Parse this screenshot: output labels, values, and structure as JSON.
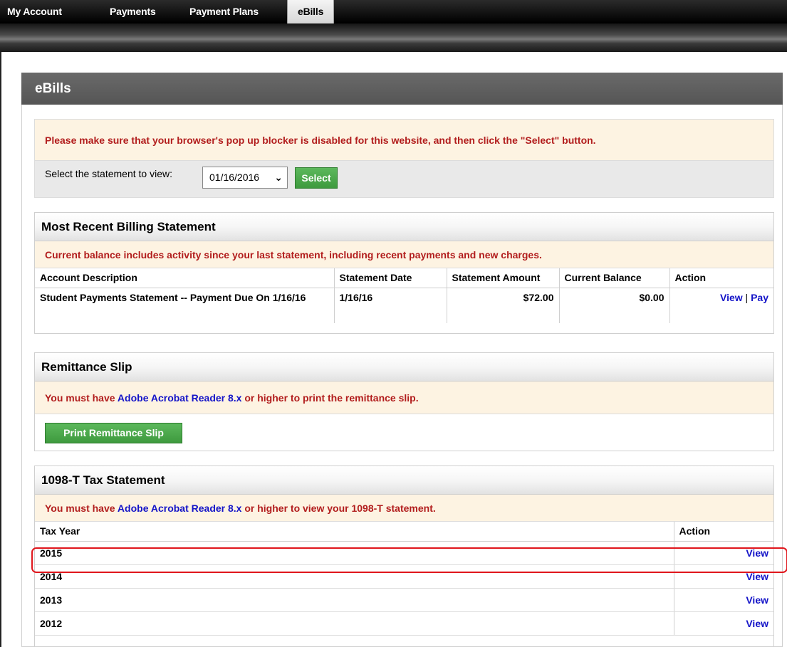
{
  "nav": {
    "tabs": [
      {
        "label": "My Account"
      },
      {
        "label": "Payments"
      },
      {
        "label": "Payment Plans"
      },
      {
        "label": "eBills",
        "active": true
      }
    ]
  },
  "page": {
    "title": "eBills",
    "popup_notice": "Please make sure that your browser's pop up blocker is disabled for this website, and then click the \"Select\" button.",
    "select_label": "Select the statement to view:",
    "statement_selected": "01/16/2016",
    "select_button": "Select"
  },
  "billing": {
    "title": "Most Recent Billing Statement",
    "note": "Current balance includes activity since your last statement, including recent payments and new charges.",
    "columns": [
      "Account Description",
      "Statement Date",
      "Statement Amount",
      "Current Balance",
      "Action"
    ],
    "row": {
      "description": "Student Payments Statement -- Payment Due On 1/16/16",
      "date": "1/16/16",
      "amount": "$72.00",
      "balance": "$0.00",
      "view": "View",
      "separator": "|",
      "pay": "Pay"
    }
  },
  "remittance": {
    "title": "Remittance Slip",
    "note_pre": "You must have",
    "note_link": "Adobe Acrobat Reader 8.x",
    "note_post": "or higher to print the remittance slip.",
    "button": "Print Remittance Slip"
  },
  "tax": {
    "title": "1098-T Tax Statement",
    "note_pre": "You must have",
    "note_link": "Adobe Acrobat Reader 8.x",
    "note_post": "or higher to view your 1098-T statement.",
    "columns": [
      "Tax Year",
      "Action"
    ],
    "rows": [
      {
        "year": "2015",
        "action": "View"
      },
      {
        "year": "2014",
        "action": "View"
      },
      {
        "year": "2013",
        "action": "View"
      },
      {
        "year": "2012",
        "action": "View"
      }
    ]
  },
  "colors": {
    "notice_text": "#b21d1d",
    "notice_bg": "#fdf3e2",
    "link": "#1414c8",
    "button_green": "#4cae4c",
    "highlight": "#e0161c"
  }
}
